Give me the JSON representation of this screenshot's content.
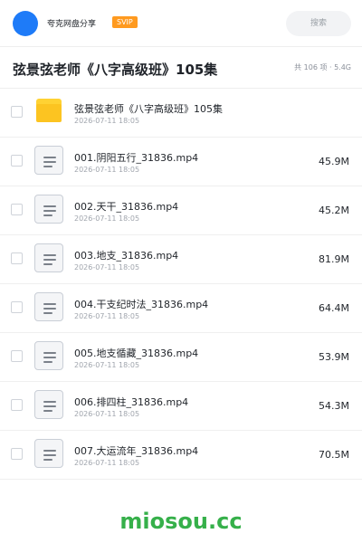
{
  "header": {
    "brand": "夸克网盘分享",
    "badge": "SVIP",
    "search_placeholder": "搜索"
  },
  "folder": {
    "title": "弦景弦老师《八字高级班》105集",
    "summary": "共 106 项 · 5.4G"
  },
  "items": [
    {
      "type": "folder",
      "name": "弦景弦老师《八字高级班》105集",
      "date": "2026-07-11 18:05",
      "size": ""
    },
    {
      "type": "file",
      "name": "001.阴阳五行_31836.mp4",
      "date": "2026-07-11 18:05",
      "size": "45.9M"
    },
    {
      "type": "file",
      "name": "002.天干_31836.mp4",
      "date": "2026-07-11 18:05",
      "size": "45.2M"
    },
    {
      "type": "file",
      "name": "003.地支_31836.mp4",
      "date": "2026-07-11 18:05",
      "size": "81.9M"
    },
    {
      "type": "file",
      "name": "004.干支纪时法_31836.mp4",
      "date": "2026-07-11 18:05",
      "size": "64.4M"
    },
    {
      "type": "file",
      "name": "005.地支循藏_31836.mp4",
      "date": "2026-07-11 18:05",
      "size": "53.9M"
    },
    {
      "type": "file",
      "name": "006.排四柱_31836.mp4",
      "date": "2026-07-11 18:05",
      "size": "54.3M"
    },
    {
      "type": "file",
      "name": "007.大运流年_31836.mp4",
      "date": "2026-07-11 18:05",
      "size": "70.5M"
    }
  ],
  "footer": {
    "watermark": "miosou.cc"
  },
  "colors": {
    "accent": "#1e7bf8",
    "badge": "#ff9a1f",
    "folder": "#fcc421",
    "watermark": "#36b04a"
  }
}
